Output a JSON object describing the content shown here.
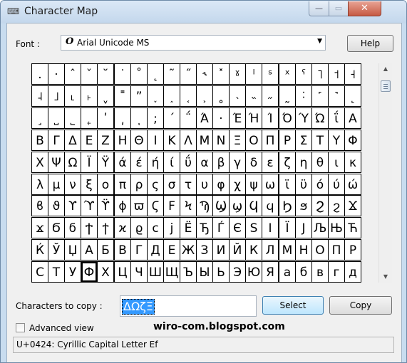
{
  "window": {
    "title": "Character Map",
    "app_icon": "character-map-icon"
  },
  "captions": {
    "minimize": "—",
    "maximize": "▭",
    "close": "✕"
  },
  "font": {
    "label": "Font :",
    "selected": "Arial Unicode MS",
    "type_glyph": "O"
  },
  "help_button": "Help",
  "grid": {
    "selected_row": 9,
    "selected_col": 3,
    "rows": [
      [
        ".",
        "·",
        "ˆ",
        "ˇ",
        "˘",
        "˙",
        "˚",
        "˛",
        "˜",
        "˝",
        "˞",
        "˟",
        "ˠ",
        "ˡ",
        "ˢ",
        "ˣ",
        "ˤ",
        "˥",
        "˦",
        "˧"
      ],
      [
        "˨",
        "˩",
        "˪",
        "˫",
        "ˬ",
        "˭",
        "ˮ",
        "˯",
        "˰",
        "˱",
        "˲",
        "˳",
        "˴",
        "˵",
        "˶",
        "˷",
        "˸",
        "˹",
        "˺",
        "˻"
      ],
      [
        "˼",
        "˽",
        "˾",
        "˿",
        "ʹ",
        "͵",
        "ͺ",
        ";",
        "΄",
        "΅",
        "Ά",
        "·",
        "Έ",
        "Ή",
        "Ί",
        "Ό",
        "Ύ",
        "Ώ",
        "ΐ",
        "Α"
      ],
      [
        "Β",
        "Γ",
        "Δ",
        "Ε",
        "Ζ",
        "Η",
        "Θ",
        "Ι",
        "Κ",
        "Λ",
        "Μ",
        "Ν",
        "Ξ",
        "Ο",
        "Π",
        "Ρ",
        "Σ",
        "Τ",
        "Υ",
        "Φ"
      ],
      [
        "Χ",
        "Ψ",
        "Ω",
        "Ϊ",
        "Ϋ",
        "ά",
        "έ",
        "ή",
        "ί",
        "ΰ",
        "α",
        "β",
        "γ",
        "δ",
        "ε",
        "ζ",
        "η",
        "θ",
        "ι",
        "κ"
      ],
      [
        "λ",
        "μ",
        "ν",
        "ξ",
        "ο",
        "π",
        "ρ",
        "ς",
        "σ",
        "τ",
        "υ",
        "φ",
        "χ",
        "ψ",
        "ω",
        "ϊ",
        "ϋ",
        "ό",
        "ύ",
        "ώ"
      ],
      [
        "ϐ",
        "ϑ",
        "ϒ",
        "ϓ",
        "ϔ",
        "ϕ",
        "ϖ",
        "Ϛ",
        "Ϝ",
        "Ϟ",
        "Ϡ",
        "Ϣ",
        "ϣ",
        "Ϥ",
        "ϥ",
        "Ϧ",
        "ϧ",
        "Ϩ",
        "ϩ",
        "Ϫ"
      ],
      [
        "ϫ",
        "Ϭ",
        "ϭ",
        "Ϯ",
        "ϯ",
        "ϰ",
        "ϱ",
        "c",
        "j",
        "Ё",
        "Ђ",
        "Ѓ",
        "Є",
        "Ѕ",
        "І",
        "Ї",
        "Ј",
        "Љ",
        "Њ",
        "Ћ"
      ],
      [
        "Ќ",
        "Ў",
        "Џ",
        "А",
        "Б",
        "В",
        "Г",
        "Д",
        "Е",
        "Ж",
        "З",
        "И",
        "Й",
        "К",
        "Л",
        "М",
        "Н",
        "О",
        "П",
        "Р"
      ],
      [
        "С",
        "Т",
        "У",
        "Ф",
        "Х",
        "Ц",
        "Ч",
        "Ш",
        "Щ",
        "Ъ",
        "Ы",
        "Ь",
        "Э",
        "Ю",
        "Я",
        "а",
        "б",
        "в",
        "г",
        "д"
      ]
    ]
  },
  "copy": {
    "label": "Characters to copy :",
    "value": "ΔΩζΞ"
  },
  "select_button": "Select",
  "copy_button": "Copy",
  "advanced_view": {
    "label": "Advanced view",
    "checked": false
  },
  "watermark": "wiro-com.blogspot.com",
  "status": "U+0424: Cyrillic Capital Letter Ef"
}
